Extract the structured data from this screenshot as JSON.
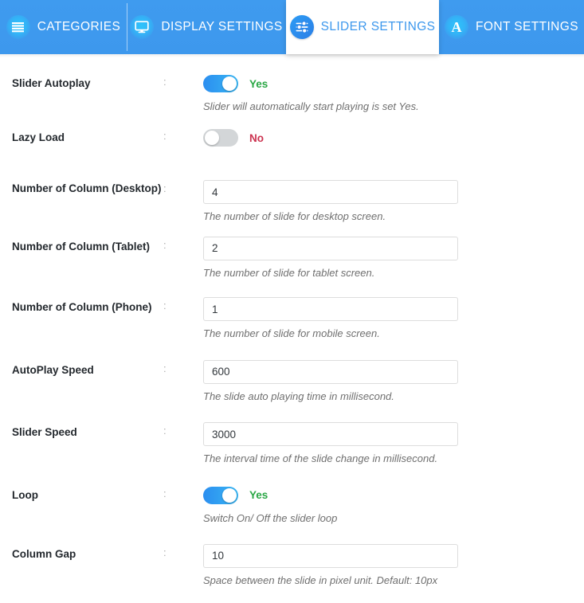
{
  "colors": {
    "tab_bar_blue": "#3d98ed",
    "active_tab_text": "#3d98ed",
    "toggle_on": "#2b8ef0",
    "toggle_off": "#d3d6d8",
    "yes_green": "#2aa745",
    "no_red": "#cc3350",
    "label_dark": "#23282d",
    "help_gray": "#6f6f6f",
    "input_border": "#dddddd"
  },
  "tabs": [
    {
      "id": "categories",
      "label": "CATEGORIES",
      "icon": "list-icon",
      "active": false
    },
    {
      "id": "display-settings",
      "label": "DISPLAY SETTINGS",
      "icon": "monitor-icon",
      "active": false
    },
    {
      "id": "slider-settings",
      "label": "SLIDER SETTINGS",
      "icon": "sliders-icon",
      "active": true
    },
    {
      "id": "font-settings",
      "label": "FONT SETTINGS",
      "icon": "font-a-icon",
      "active": false
    }
  ],
  "separator": ":",
  "fields": {
    "slider_autoplay": {
      "label": "Slider Autoplay",
      "type": "toggle",
      "state": "on",
      "state_text": "Yes",
      "help": "Slider will automatically start playing is set Yes."
    },
    "lazy_load": {
      "label": "Lazy Load",
      "type": "toggle",
      "state": "off",
      "state_text": "No",
      "help": ""
    },
    "columns_desktop": {
      "label": "Number of Column (Desktop)",
      "type": "text",
      "value": "4",
      "placeholder": "",
      "help": "The number of slide for desktop screen."
    },
    "columns_tablet": {
      "label": "Number of Column (Tablet)",
      "type": "text",
      "value": "2",
      "placeholder": "",
      "help": "The number of slide for tablet screen."
    },
    "columns_phone": {
      "label": "Number of Column (Phone)",
      "type": "text",
      "value": "1",
      "placeholder": "",
      "help": "The number of slide for mobile screen."
    },
    "autoplay_speed": {
      "label": "AutoPlay Speed",
      "type": "text",
      "value": "600",
      "placeholder": "",
      "help": "The slide auto playing time in millisecond."
    },
    "slider_speed": {
      "label": "Slider Speed",
      "type": "text",
      "value": "3000",
      "placeholder": "",
      "help": "The interval time of the slide change in millisecond."
    },
    "loop": {
      "label": "Loop",
      "type": "toggle",
      "state": "on",
      "state_text": "Yes",
      "help": "Switch On/ Off the slider loop"
    },
    "column_gap": {
      "label": "Column Gap",
      "type": "text",
      "value": "10",
      "placeholder": "",
      "help": "Space between the slide in pixel unit. Default: 10px"
    }
  }
}
